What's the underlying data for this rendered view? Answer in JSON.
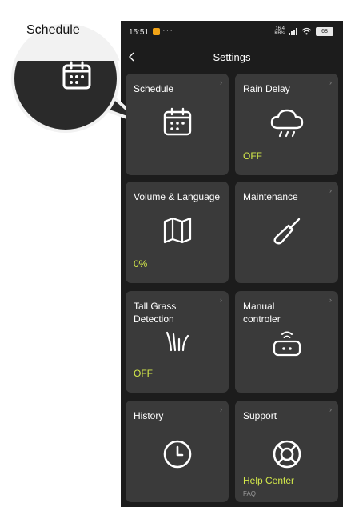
{
  "callout": {
    "label": "Schedule"
  },
  "statusbar": {
    "time": "15:51",
    "dots": "···",
    "net_speed": "16.4 KB/s",
    "battery": "68"
  },
  "nav": {
    "title": "Settings"
  },
  "cards": {
    "schedule": {
      "title": "Schedule",
      "icon": "calendar-icon"
    },
    "rain_delay": {
      "title": "Rain Delay",
      "icon": "rain-cloud-icon",
      "status": "OFF"
    },
    "volume_language": {
      "title": "Volume & Language",
      "icon": "map-icon",
      "status": "0%"
    },
    "maintenance": {
      "title": "Maintenance",
      "icon": "screwdriver-icon"
    },
    "tall_grass": {
      "title": "Tall Grass\nDetection",
      "icon": "grass-icon",
      "status": "OFF"
    },
    "manual_controller": {
      "title": "Manual\ncontroler",
      "icon": "remote-controller-icon"
    },
    "history": {
      "title": "History",
      "icon": "clock-icon"
    },
    "support": {
      "title": "Support",
      "icon": "lifebuoy-icon",
      "status": "Help Center",
      "sub": "FAQ"
    }
  },
  "colors": {
    "accent": "#d3e84a",
    "card_bg": "#3a3a3a",
    "screen_bg": "#1c1c1c"
  }
}
